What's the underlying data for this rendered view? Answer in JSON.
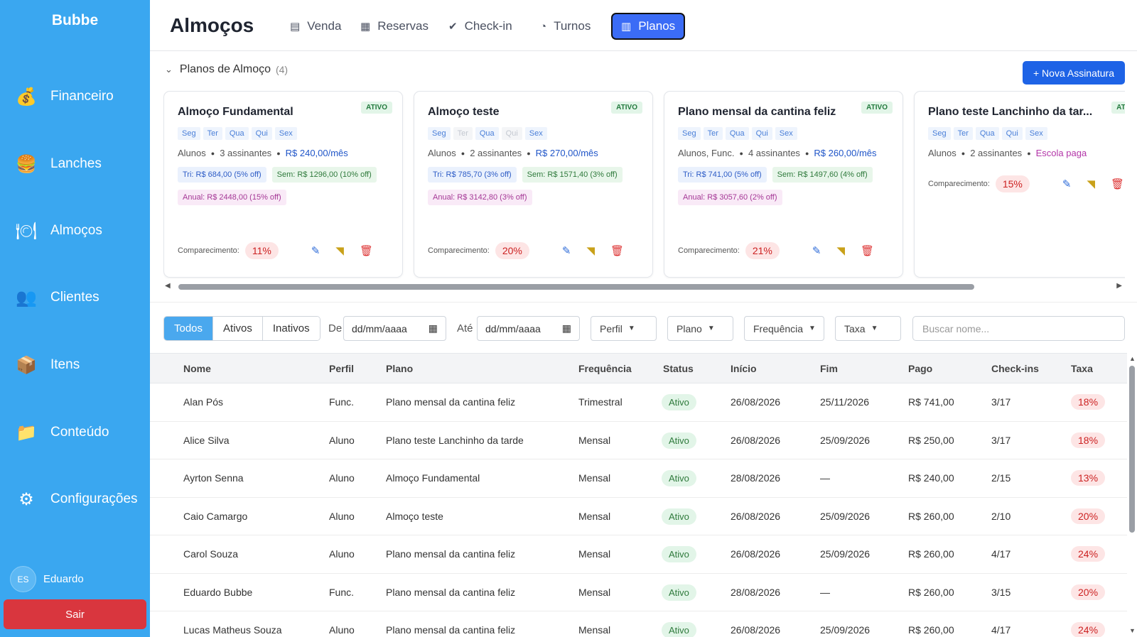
{
  "app": {
    "brand": "Bubbe"
  },
  "sidebar": {
    "items": [
      {
        "label": "Financeiro",
        "icon": "money-bag-icon",
        "glyph": "💰"
      },
      {
        "label": "Lanches",
        "icon": "burger-icon",
        "glyph": "🍔"
      },
      {
        "label": "Almoços",
        "icon": "plate-icon",
        "glyph": "🍽"
      },
      {
        "label": "Clientes",
        "icon": "users-icon",
        "glyph": "👥"
      },
      {
        "label": "Itens",
        "icon": "box-icon",
        "glyph": "📦"
      },
      {
        "label": "Conteúdo",
        "icon": "folder-icon",
        "glyph": "📁"
      },
      {
        "label": "Configurações",
        "icon": "gear-icon",
        "glyph": "⚙"
      }
    ],
    "user": {
      "initials": "ES",
      "name": "Eduardo"
    },
    "logout_label": "Sair"
  },
  "header": {
    "title": "Almoços",
    "tabs": [
      {
        "label": "Venda",
        "icon": "cart-icon",
        "glyph": "▤"
      },
      {
        "label": "Reservas",
        "icon": "calendar-icon",
        "glyph": "▦"
      },
      {
        "label": "Check-in",
        "icon": "checkbox-icon",
        "glyph": "✔"
      },
      {
        "label": "Turnos",
        "icon": "clock-icon",
        "glyph": "◔"
      },
      {
        "label": "Planos",
        "icon": "clipboard-icon",
        "glyph": "▥",
        "active": true
      }
    ]
  },
  "plans_section": {
    "title": "Planos de Almoço",
    "count": "(4)",
    "new_button": "+ Nova Assinatura",
    "attendance_label": "Comparecimento:",
    "cards": [
      {
        "name": "Almoço Fundamental",
        "status": "ATIVO",
        "days": [
          {
            "d": "Seg",
            "on": true
          },
          {
            "d": "Ter",
            "on": true
          },
          {
            "d": "Qua",
            "on": true
          },
          {
            "d": "Qui",
            "on": true
          },
          {
            "d": "Sex",
            "on": true
          }
        ],
        "audience": "Alunos",
        "subscribers": "3 assinantes",
        "price": "R$ 240,00/mês",
        "discounts": [
          {
            "kind": "tri",
            "text": "Tri: R$ 684,00 (5% off)"
          },
          {
            "kind": "sem",
            "text": "Sem: R$ 1296,00 (10% off)"
          },
          {
            "kind": "anual",
            "text": "Anual: R$ 2448,00 (15% off)"
          }
        ],
        "attendance": "11%"
      },
      {
        "name": "Almoço teste",
        "status": "ATIVO",
        "days": [
          {
            "d": "Seg",
            "on": true
          },
          {
            "d": "Ter",
            "on": false
          },
          {
            "d": "Qua",
            "on": true
          },
          {
            "d": "Qui",
            "on": false
          },
          {
            "d": "Sex",
            "on": true
          }
        ],
        "audience": "Alunos",
        "subscribers": "2 assinantes",
        "price": "R$ 270,00/mês",
        "discounts": [
          {
            "kind": "tri",
            "text": "Tri: R$ 785,70 (3% off)"
          },
          {
            "kind": "sem",
            "text": "Sem: R$ 1571,40 (3% off)"
          },
          {
            "kind": "anual",
            "text": "Anual: R$ 3142,80 (3% off)"
          }
        ],
        "attendance": "20%"
      },
      {
        "name": "Plano mensal da cantina feliz",
        "status": "ATIVO",
        "days": [
          {
            "d": "Seg",
            "on": true
          },
          {
            "d": "Ter",
            "on": true
          },
          {
            "d": "Qua",
            "on": true
          },
          {
            "d": "Qui",
            "on": true
          },
          {
            "d": "Sex",
            "on": true
          }
        ],
        "audience": "Alunos, Func.",
        "subscribers": "4 assinantes",
        "price": "R$ 260,00/mês",
        "discounts": [
          {
            "kind": "tri",
            "text": "Tri: R$ 741,00 (5% off)"
          },
          {
            "kind": "sem",
            "text": "Sem: R$ 1497,60 (4% off)"
          },
          {
            "kind": "anual",
            "text": "Anual: R$ 3057,60 (2% off)"
          }
        ],
        "attendance": "21%"
      },
      {
        "name": "Plano teste Lanchinho da tar...",
        "status": "ATIVO",
        "days": [
          {
            "d": "Seg",
            "on": true
          },
          {
            "d": "Ter",
            "on": true
          },
          {
            "d": "Qua",
            "on": true
          },
          {
            "d": "Qui",
            "on": true
          },
          {
            "d": "Sex",
            "on": true
          }
        ],
        "audience": "Alunos",
        "subscribers": "2 assinantes",
        "price": "Escola paga",
        "price_style": "school",
        "discounts": [],
        "attendance": "15%"
      }
    ]
  },
  "filters": {
    "status_options": [
      {
        "label": "Todos",
        "active": true
      },
      {
        "label": "Ativos",
        "active": false
      },
      {
        "label": "Inativos",
        "active": false
      }
    ],
    "from_label": "De",
    "to_label": "Até",
    "date_placeholder": "dd/mm/aaaa",
    "dropdowns": [
      "Perfil",
      "Plano",
      "Frequência",
      "Taxa"
    ],
    "search_placeholder": "Buscar nome..."
  },
  "table": {
    "columns": [
      "Nome",
      "Perfil",
      "Plano",
      "Frequência",
      "Status",
      "Início",
      "Fim",
      "Pago",
      "Check-ins",
      "Taxa"
    ],
    "rows": [
      [
        "Alan Pós",
        "Func.",
        "Plano mensal da cantina feliz",
        "Trimestral",
        "Ativo",
        "26/08/2026",
        "25/11/2026",
        "R$ 741,00",
        "3/17",
        "18%"
      ],
      [
        "Alice Silva",
        "Aluno",
        "Plano teste Lanchinho da tarde",
        "Mensal",
        "Ativo",
        "26/08/2026",
        "25/09/2026",
        "R$ 250,00",
        "3/17",
        "18%"
      ],
      [
        "Ayrton Senna",
        "Aluno",
        "Almoço Fundamental",
        "Mensal",
        "Ativo",
        "28/08/2026",
        "—",
        "R$ 240,00",
        "2/15",
        "13%"
      ],
      [
        "Caio Camargo",
        "Aluno",
        "Almoço teste",
        "Mensal",
        "Ativo",
        "26/08/2026",
        "25/09/2026",
        "R$ 260,00",
        "2/10",
        "20%"
      ],
      [
        "Carol Souza",
        "Aluno",
        "Plano mensal da cantina feliz",
        "Mensal",
        "Ativo",
        "26/08/2026",
        "25/09/2026",
        "R$ 260,00",
        "4/17",
        "24%"
      ],
      [
        "Eduardo Bubbe",
        "Func.",
        "Plano mensal da cantina feliz",
        "Mensal",
        "Ativo",
        "28/08/2026",
        "—",
        "R$ 260,00",
        "3/15",
        "20%"
      ],
      [
        "Lucas Matheus Souza",
        "Aluno",
        "Plano mensal da cantina feliz",
        "Mensal",
        "Ativo",
        "26/08/2026",
        "25/09/2026",
        "R$ 260,00",
        "4/17",
        "24%"
      ]
    ]
  },
  "colors": {
    "sidebar": "#3aa7f0",
    "accent": "#3b6cf6",
    "primary_button": "#1e63e6",
    "logout": "#d9363e"
  }
}
